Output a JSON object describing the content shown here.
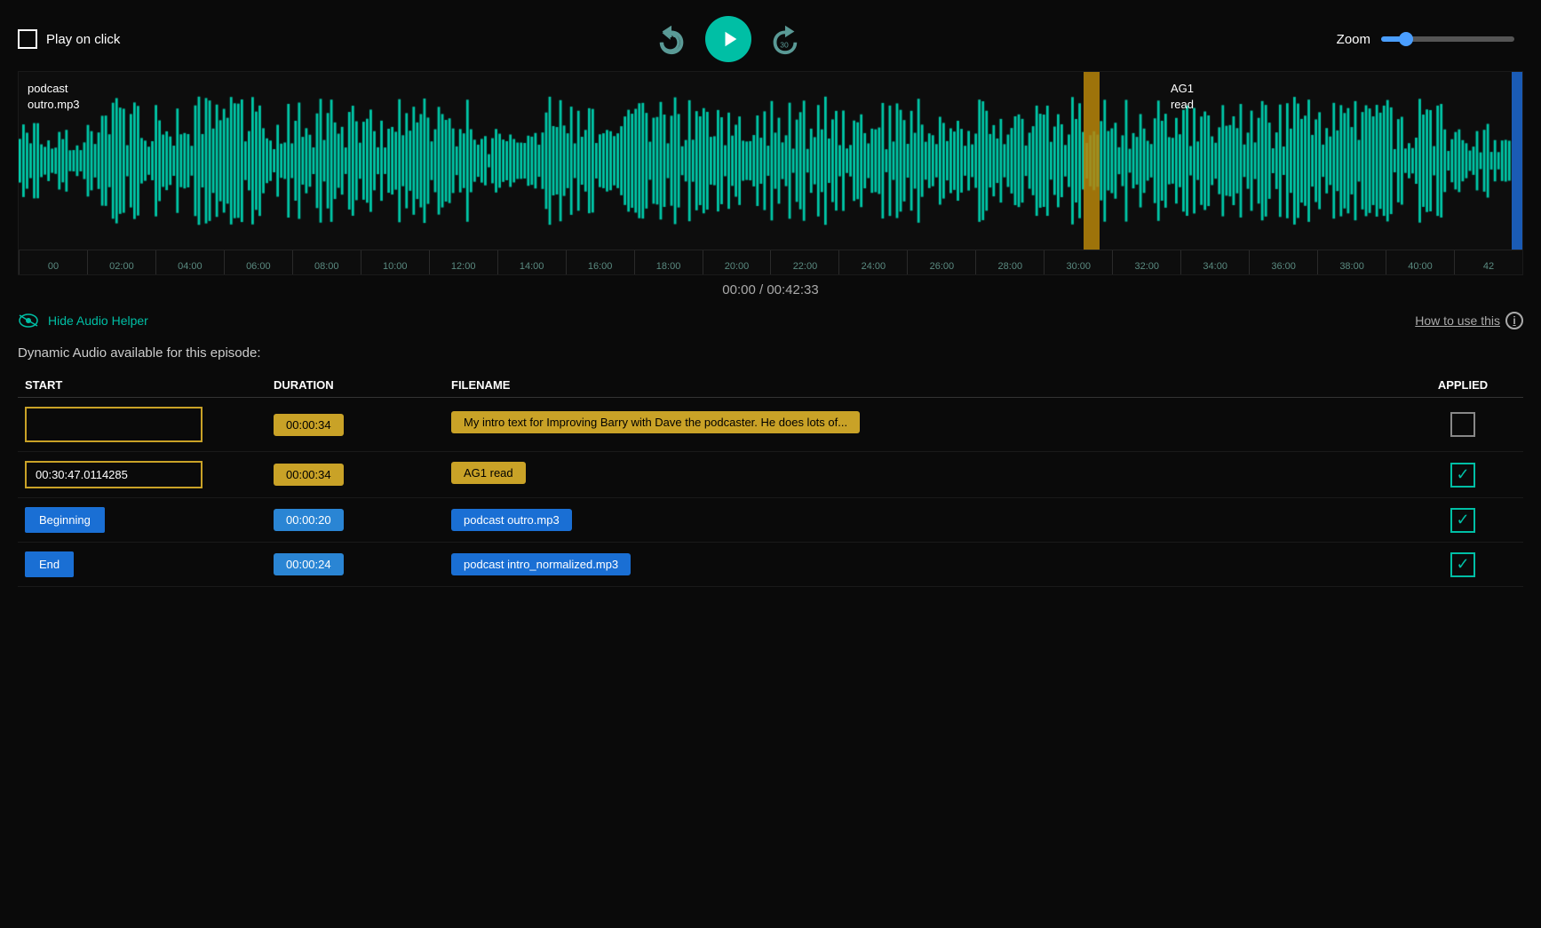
{
  "topBar": {
    "playOnClick": "Play on click",
    "zoom": {
      "label": "Zoom",
      "value": 15
    }
  },
  "transport": {
    "rewind10Label": "⟨10",
    "forward30Label": "30⟩",
    "playLabel": "▶"
  },
  "waveform": {
    "trackLabel1": "podcast",
    "trackLabel2": "outro.mp3",
    "ag1Label1": "AG1",
    "ag1Label2": "read",
    "timeDisplay": "00:00 / 00:42:33"
  },
  "timeline": {
    "ticks": [
      "00",
      "02:00",
      "04:00",
      "06:00",
      "08:00",
      "10:00",
      "12:00",
      "14:00",
      "16:00",
      "18:00",
      "20:00",
      "22:00",
      "24:00",
      "26:00",
      "28:00",
      "30:00",
      "32:00",
      "34:00",
      "36:00",
      "38:00",
      "40:00",
      "42"
    ]
  },
  "audioHelper": {
    "hideLabel": "Hide Audio Helper",
    "howToUseLabel": "How to use this",
    "infoIcon": "i"
  },
  "dynamicAudio": {
    "sectionTitle": "Dynamic Audio available for this episode:",
    "columns": {
      "start": "START",
      "duration": "DURATION",
      "filename": "FILENAME",
      "applied": "APPLIED"
    },
    "rows": [
      {
        "start": "",
        "startType": "empty",
        "duration": "00:00:34",
        "durationColor": "yellow",
        "filename": "My intro text for Improving Barry with Dave the podcaster. He does lots of...",
        "filenameColor": "yellow",
        "applied": false
      },
      {
        "start": "00:30:47.0114285",
        "startType": "input",
        "duration": "00:00:34",
        "durationColor": "yellow",
        "filename": "AG1 read",
        "filenameColor": "yellow",
        "applied": true
      },
      {
        "start": "Beginning",
        "startType": "button",
        "duration": "00:00:20",
        "durationColor": "blue",
        "filename": "podcast outro.mp3",
        "filenameColor": "blue",
        "applied": true
      },
      {
        "start": "End",
        "startType": "button",
        "duration": "00:00:24",
        "durationColor": "blue",
        "filename": "podcast intro_normalized.mp3",
        "filenameColor": "blue",
        "applied": true
      }
    ]
  }
}
